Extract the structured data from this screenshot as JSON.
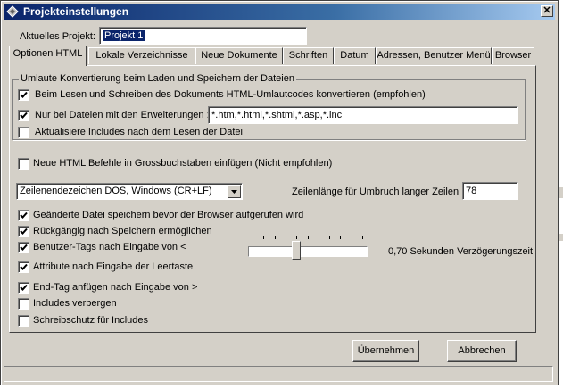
{
  "window": {
    "title": "Projekteinstellungen",
    "close_label": "✕"
  },
  "project": {
    "label": "Aktuelles Projekt:",
    "value": "Projekt 1"
  },
  "tabs": [
    {
      "label": "Optionen HTML",
      "active": true
    },
    {
      "label": "Lokale Verzeichnisse",
      "active": false
    },
    {
      "label": "Neue Dokumente",
      "active": false
    },
    {
      "label": "Schriften",
      "active": false
    },
    {
      "label": "Datum",
      "active": false
    },
    {
      "label": "Adressen, Benutzer Menü",
      "active": false
    },
    {
      "label": "Browser",
      "active": false
    }
  ],
  "umlaut_group": {
    "legend": "Umlaute Konvertierung beim Laden und Speichern der Dateien",
    "convert_label": "Beim Lesen und Schreiben des Dokuments HTML-Umlautcodes konvertieren (empfohlen)",
    "convert_checked": true,
    "extensions_label": "Nur bei Dateien mit den Erweiterungen :",
    "extensions_checked": true,
    "extensions_value": "*.htm,*.html,*.shtml,*.asp,*.inc",
    "includes_label": "Aktualisiere Includes nach dem Lesen der Datei",
    "includes_checked": false
  },
  "uppercase": {
    "label": "Neue HTML Befehle in Grossbuchstaben einfügen (Nicht empfohlen)",
    "checked": false
  },
  "line_ending": {
    "value": "Zeilenendezeichen  DOS, Windows (CR+LF)"
  },
  "line_length": {
    "label": "Zeilenlänge für Umbruch langer Zeilen :",
    "value": "78"
  },
  "options": [
    {
      "label": "Geänderte Datei speichern bevor der Browser aufgerufen wird",
      "checked": true
    },
    {
      "label": "Rückgängig nach Speichern ermöglichen",
      "checked": true
    },
    {
      "label": "Benutzer-Tags nach Eingabe von <",
      "checked": true
    },
    {
      "label": "Attribute nach Eingabe der Leertaste",
      "checked": true
    },
    {
      "label": "End-Tag anfügen nach Eingabe von >",
      "checked": true
    },
    {
      "label": "Includes verbergen",
      "checked": false
    },
    {
      "label": "Schreibschutz für Includes",
      "checked": false
    }
  ],
  "delay": {
    "label": "0,70 Sekunden Verzögerungszeit",
    "slider_fraction": 0.4
  },
  "buttons": {
    "apply": "Übernehmen",
    "cancel": "Abbrechen"
  },
  "colors": {
    "face": "#d4d0c8",
    "title_start": "#0a246a",
    "title_end": "#a6caf0",
    "selection": "#0a246a"
  }
}
